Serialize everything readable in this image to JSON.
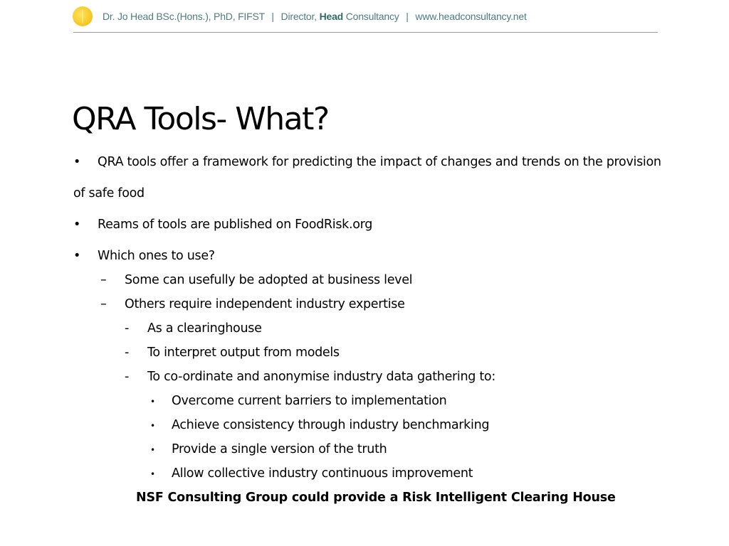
{
  "header": {
    "logo_icon": "sun-logo-icon",
    "name": "Dr. Jo Head BSc.(Hons.), PhD, FIFST",
    "separator": "|",
    "role_prefix": "Director,",
    "company_strong": "Head",
    "company_rest": "Consultancy",
    "website": "www.headconsultancy.net"
  },
  "slide": {
    "title": "QRA Tools- What?",
    "bullets": [
      {
        "marker": "•",
        "text_line1": "QRA tools offer a framework for predicting the impact of changes and trends on the provision",
        "text_line2": "of safe food"
      },
      {
        "marker": "•",
        "text": "Reams of tools are published on FoodRisk.org"
      },
      {
        "marker": "•",
        "text": "Which ones to use?",
        "children": [
          {
            "marker": "–",
            "text": "Some can usefully be adopted at business level"
          },
          {
            "marker": "–",
            "text": "Others require independent industry expertise",
            "children": [
              {
                "marker": "-",
                "text": "As a clearinghouse"
              },
              {
                "marker": "-",
                "text": "To interpret output from models"
              },
              {
                "marker": "-",
                "text": "To co-ordinate and anonymise industry data gathering to:",
                "children": [
                  {
                    "marker": "•",
                    "text": "Overcome current barriers to implementation"
                  },
                  {
                    "marker": "•",
                    "text": "Achieve consistency through industry benchmarking"
                  },
                  {
                    "marker": "•",
                    "text": "Provide a single version of the truth"
                  },
                  {
                    "marker": "•",
                    "text": "Allow collective industry continuous improvement"
                  }
                ]
              }
            ]
          }
        ]
      }
    ],
    "closing": "NSF Consulting Group could provide a Risk Intelligent Clearing House"
  }
}
